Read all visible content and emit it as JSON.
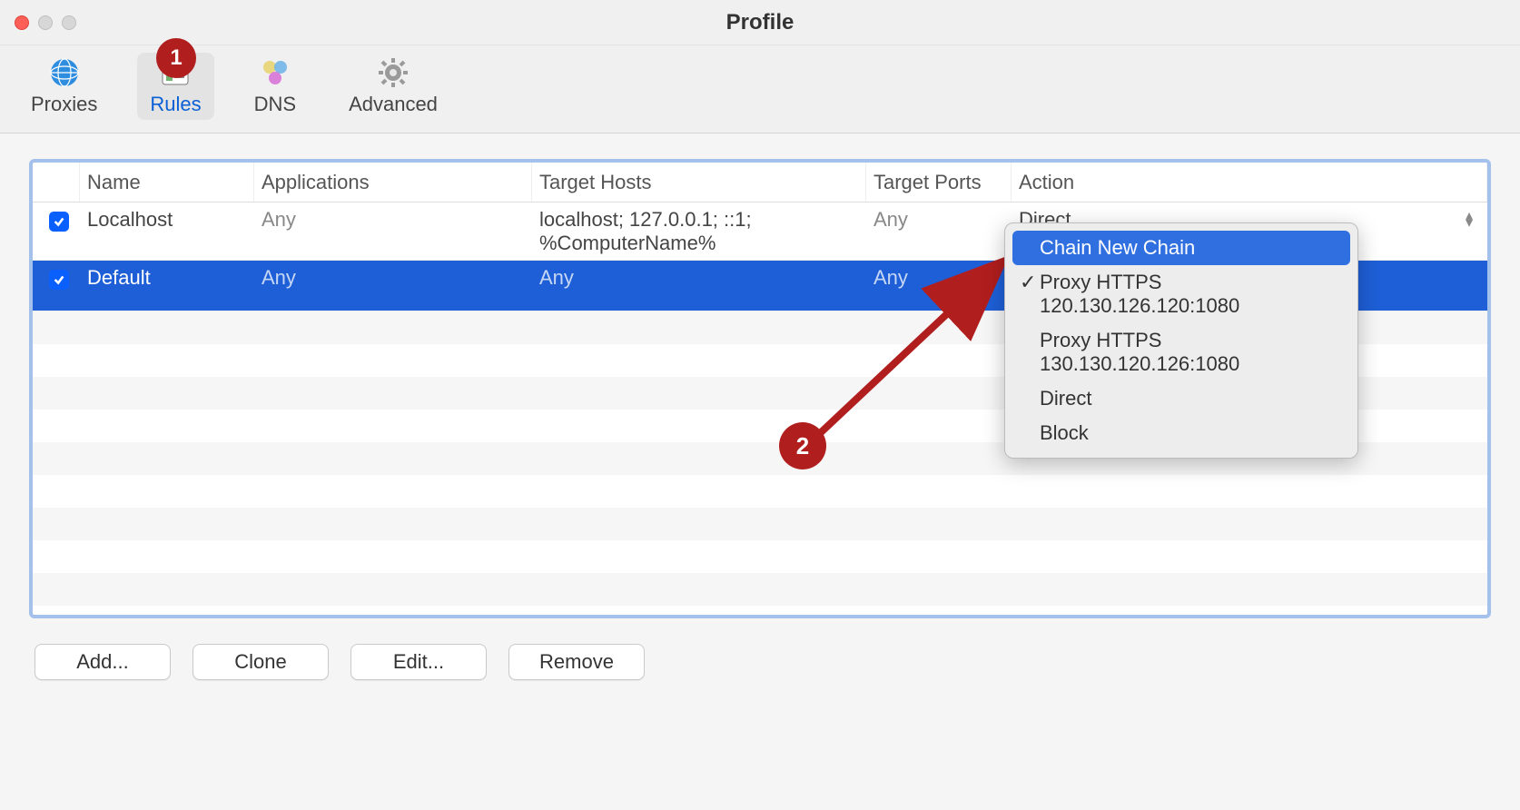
{
  "window": {
    "title": "Profile"
  },
  "toolbar": [
    {
      "label": "Proxies"
    },
    {
      "label": "Rules"
    },
    {
      "label": "DNS"
    },
    {
      "label": "Advanced"
    }
  ],
  "annot": {
    "badge1": "1",
    "badge2": "2"
  },
  "columns": {
    "name": "Name",
    "apps": "Applications",
    "hosts": "Target Hosts",
    "ports": "Target Ports",
    "action": "Action"
  },
  "rows": [
    {
      "name": "Localhost",
      "apps": "Any",
      "hosts": "localhost; 127.0.0.1; ::1; %ComputerName%",
      "ports": "Any",
      "action": "Direct"
    },
    {
      "name": "Default",
      "apps": "Any",
      "hosts": "Any",
      "ports": "Any",
      "action": ""
    }
  ],
  "dropdown": {
    "items": [
      "Chain New Chain",
      "Proxy HTTPS 120.130.126.120:1080",
      "Proxy HTTPS 130.130.120.126:1080",
      "Direct",
      "Block"
    ]
  },
  "buttons": {
    "add": "Add...",
    "clone": "Clone",
    "edit": "Edit...",
    "remove": "Remove"
  }
}
